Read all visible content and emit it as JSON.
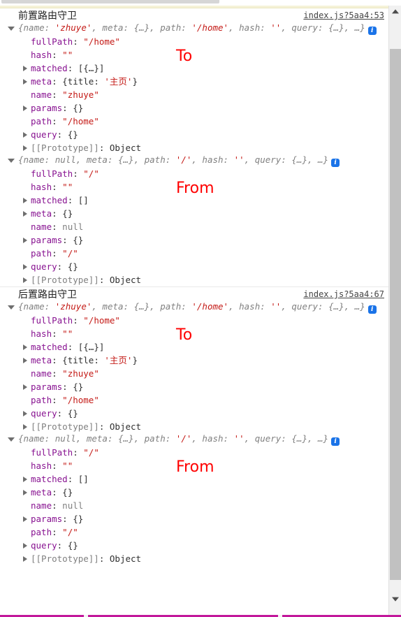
{
  "window": {
    "scrollbar": {
      "up_arrow": "scroll-up",
      "down_arrow": "scroll-down"
    }
  },
  "console": {
    "messages": [
      {
        "title": "前置路由守卫",
        "source": "index.js?5aa4:53",
        "objects": [
          {
            "annotation": "To",
            "preview_segments": [
              {
                "text": "{name: ",
                "cls": "k"
              },
              {
                "text": "'zhuye'",
                "cls": "s"
              },
              {
                "text": ", meta: {…}, path: ",
                "cls": "k"
              },
              {
                "text": "'/home'",
                "cls": "s"
              },
              {
                "text": ", hash: ",
                "cls": "k"
              },
              {
                "text": "''",
                "cls": "s"
              },
              {
                "text": ", query: {…}, …}",
                "cls": "k"
              }
            ],
            "info_badge": "i",
            "properties": [
              {
                "expandable": false,
                "name": "fullPath",
                "value": "\"/home\"",
                "value_class": "pstr"
              },
              {
                "expandable": false,
                "name": "hash",
                "value": "\"\"",
                "value_class": "pstr"
              },
              {
                "expandable": true,
                "name": "matched",
                "value": "[{…}]",
                "value_class": "pempty"
              },
              {
                "expandable": true,
                "name": "meta",
                "value": "{title: '主页'}",
                "value_class": "pmeta"
              },
              {
                "expandable": false,
                "name": "name",
                "value": "\"zhuye\"",
                "value_class": "pstr"
              },
              {
                "expandable": true,
                "name": "params",
                "value": "{}",
                "value_class": "pempty"
              },
              {
                "expandable": false,
                "name": "path",
                "value": "\"/home\"",
                "value_class": "pstr"
              },
              {
                "expandable": true,
                "name": "query",
                "value": "{}",
                "value_class": "pempty"
              },
              {
                "expandable": true,
                "name": "[[Prototype]]",
                "value": "Object",
                "value_class": "pobj",
                "proto": true
              }
            ]
          },
          {
            "annotation": "From",
            "preview_segments": [
              {
                "text": "{name: ",
                "cls": "k"
              },
              {
                "text": "null",
                "cls": "n"
              },
              {
                "text": ", meta: {…}, path: ",
                "cls": "k"
              },
              {
                "text": "'/'",
                "cls": "s"
              },
              {
                "text": ", hash: ",
                "cls": "k"
              },
              {
                "text": "''",
                "cls": "s"
              },
              {
                "text": ", query: {…}, …}",
                "cls": "k"
              }
            ],
            "info_badge": "i",
            "properties": [
              {
                "expandable": false,
                "name": "fullPath",
                "value": "\"/\"",
                "value_class": "pstr"
              },
              {
                "expandable": false,
                "name": "hash",
                "value": "\"\"",
                "value_class": "pstr"
              },
              {
                "expandable": true,
                "name": "matched",
                "value": "[]",
                "value_class": "pempty"
              },
              {
                "expandable": true,
                "name": "meta",
                "value": "{}",
                "value_class": "pempty"
              },
              {
                "expandable": false,
                "name": "name",
                "value": "null",
                "value_class": "pnull"
              },
              {
                "expandable": true,
                "name": "params",
                "value": "{}",
                "value_class": "pempty"
              },
              {
                "expandable": false,
                "name": "path",
                "value": "\"/\"",
                "value_class": "pstr"
              },
              {
                "expandable": true,
                "name": "query",
                "value": "{}",
                "value_class": "pempty"
              },
              {
                "expandable": true,
                "name": "[[Prototype]]",
                "value": "Object",
                "value_class": "pobj",
                "proto": true
              }
            ]
          }
        ]
      },
      {
        "title": "后置路由守卫",
        "source": "index.js?5aa4:67",
        "objects": [
          {
            "annotation": "To",
            "preview_segments": [
              {
                "text": "{name: ",
                "cls": "k"
              },
              {
                "text": "'zhuye'",
                "cls": "s"
              },
              {
                "text": ", meta: {…}, path: ",
                "cls": "k"
              },
              {
                "text": "'/home'",
                "cls": "s"
              },
              {
                "text": ", hash: ",
                "cls": "k"
              },
              {
                "text": "''",
                "cls": "s"
              },
              {
                "text": ", query: {…}, …}",
                "cls": "k"
              }
            ],
            "info_badge": "i",
            "properties": [
              {
                "expandable": false,
                "name": "fullPath",
                "value": "\"/home\"",
                "value_class": "pstr"
              },
              {
                "expandable": false,
                "name": "hash",
                "value": "\"\"",
                "value_class": "pstr"
              },
              {
                "expandable": true,
                "name": "matched",
                "value": "[{…}]",
                "value_class": "pempty"
              },
              {
                "expandable": true,
                "name": "meta",
                "value": "{title: '主页'}",
                "value_class": "pmeta"
              },
              {
                "expandable": false,
                "name": "name",
                "value": "\"zhuye\"",
                "value_class": "pstr"
              },
              {
                "expandable": true,
                "name": "params",
                "value": "{}",
                "value_class": "pempty"
              },
              {
                "expandable": false,
                "name": "path",
                "value": "\"/home\"",
                "value_class": "pstr"
              },
              {
                "expandable": true,
                "name": "query",
                "value": "{}",
                "value_class": "pempty"
              },
              {
                "expandable": true,
                "name": "[[Prototype]]",
                "value": "Object",
                "value_class": "pobj",
                "proto": true
              }
            ]
          },
          {
            "annotation": "From",
            "preview_segments": [
              {
                "text": "{name: ",
                "cls": "k"
              },
              {
                "text": "null",
                "cls": "n"
              },
              {
                "text": ", meta: {…}, path: ",
                "cls": "k"
              },
              {
                "text": "'/'",
                "cls": "s"
              },
              {
                "text": ", hash: ",
                "cls": "k"
              },
              {
                "text": "''",
                "cls": "s"
              },
              {
                "text": ", query: {…}, …}",
                "cls": "k"
              }
            ],
            "info_badge": "i",
            "properties": [
              {
                "expandable": false,
                "name": "fullPath",
                "value": "\"/\"",
                "value_class": "pstr"
              },
              {
                "expandable": false,
                "name": "hash",
                "value": "\"\"",
                "value_class": "pstr"
              },
              {
                "expandable": true,
                "name": "matched",
                "value": "[]",
                "value_class": "pempty"
              },
              {
                "expandable": true,
                "name": "meta",
                "value": "{}",
                "value_class": "pempty"
              },
              {
                "expandable": false,
                "name": "name",
                "value": "null",
                "value_class": "pnull"
              },
              {
                "expandable": true,
                "name": "params",
                "value": "{}",
                "value_class": "pempty"
              },
              {
                "expandable": false,
                "name": "path",
                "value": "\"/\"",
                "value_class": "pstr"
              },
              {
                "expandable": true,
                "name": "query",
                "value": "{}",
                "value_class": "pempty"
              },
              {
                "expandable": true,
                "name": "[[Prototype]]",
                "value": "Object",
                "value_class": "pobj",
                "proto": true
              }
            ]
          }
        ]
      }
    ]
  },
  "colors": {
    "property_name": "#881391",
    "string_value": "#c41a16",
    "null_value": "#808080",
    "annotation_red": "#ff0000",
    "info_badge_blue": "#1a73e8",
    "bottom_rule": "#c2179b"
  }
}
